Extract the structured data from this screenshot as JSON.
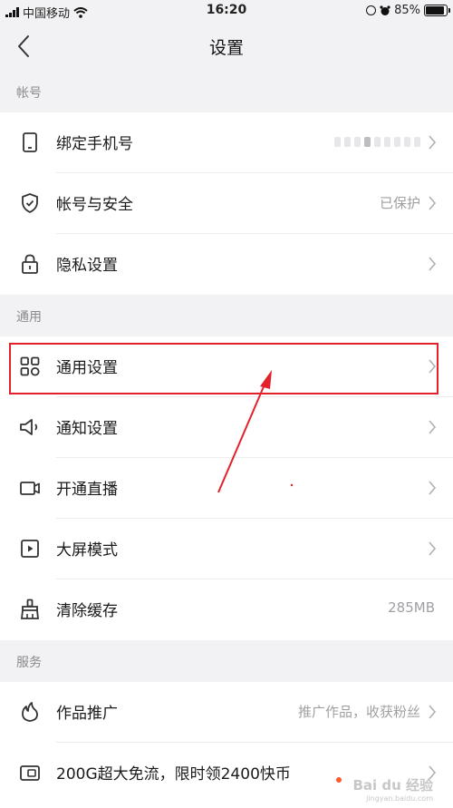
{
  "status_bar": {
    "carrier": "中国移动",
    "time": "16:20",
    "battery": "85%",
    "battery_level": 0.85
  },
  "nav": {
    "title": "设置"
  },
  "sections": {
    "account": "帐号",
    "general": "通用",
    "services": "服务"
  },
  "rows": {
    "bind_phone": {
      "label": "绑定手机号",
      "icon": "phone-icon"
    },
    "account_security": {
      "label": "帐号与安全",
      "value": "已保护",
      "icon": "shield-icon"
    },
    "privacy": {
      "label": "隐私设置",
      "icon": "lock-icon"
    },
    "general_settings": {
      "label": "通用设置",
      "icon": "grid-icon"
    },
    "notification": {
      "label": "通知设置",
      "icon": "speaker-icon"
    },
    "live": {
      "label": "开通直播",
      "icon": "camera-icon"
    },
    "big_screen": {
      "label": "大屏模式",
      "icon": "play-icon"
    },
    "clear_cache": {
      "label": "清除缓存",
      "value": "285MB",
      "icon": "broom-icon"
    },
    "promotion": {
      "label": "作品推广",
      "value": "推广作品，收获粉丝",
      "icon": "flame-icon"
    },
    "free_data": {
      "label": "200G超大免流，限时领2400快币",
      "icon": "sim-card-icon"
    }
  },
  "annotation_color": "#e2212a",
  "watermark": {
    "text": "Bai du 经验",
    "sub": "jingyan.baidu.com"
  }
}
